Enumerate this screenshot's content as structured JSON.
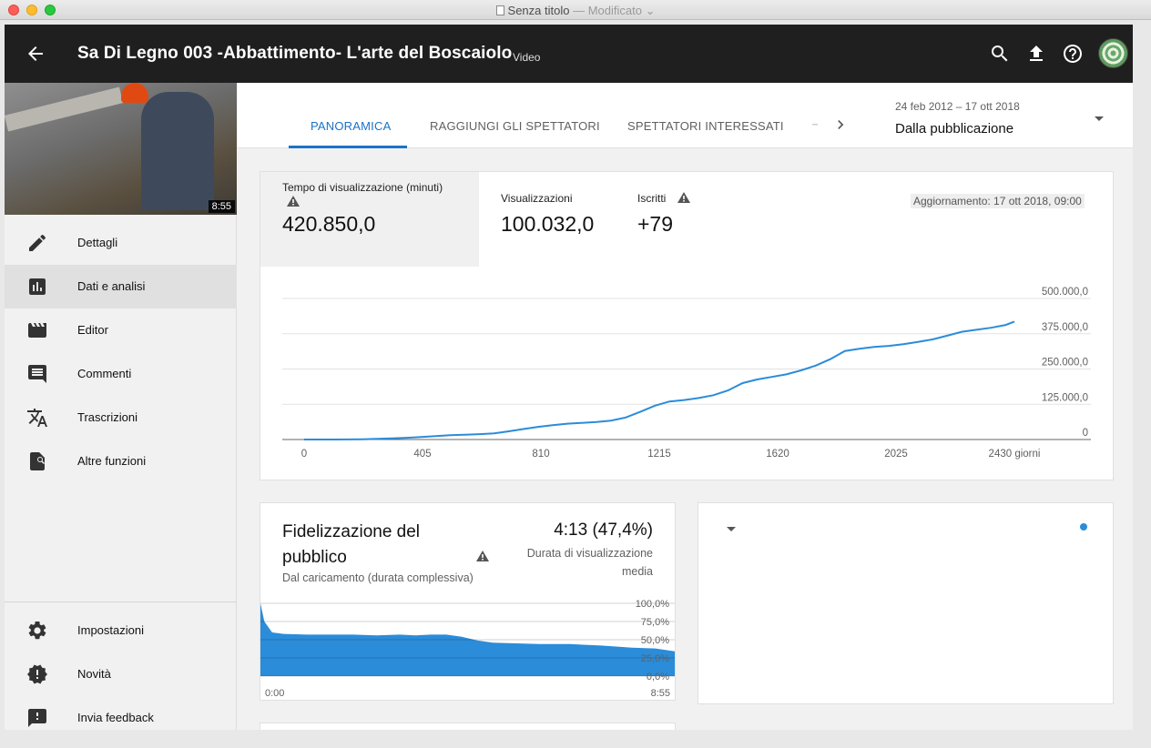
{
  "window": {
    "title": "Senza titolo",
    "status": "— Modificato ⌄"
  },
  "header": {
    "video_title": "Sa Di Legno 003 -Abbattimento- L'arte del Boscaiolo",
    "video_tag": "Video",
    "icons": [
      "arrow-back-icon",
      "search-icon",
      "upload-icon",
      "help-icon",
      "avatar"
    ]
  },
  "sidebar": {
    "thumbnail_duration": "8:55",
    "items": [
      {
        "label": "Dettagli",
        "icon": "pencil-icon"
      },
      {
        "label": "Dati e analisi",
        "icon": "analytics-icon"
      },
      {
        "label": "Editor",
        "icon": "clapperboard-icon"
      },
      {
        "label": "Commenti",
        "icon": "comment-icon"
      },
      {
        "label": "Trascrizioni",
        "icon": "translate-icon"
      },
      {
        "label": "Altre funzioni",
        "icon": "more-features-icon"
      }
    ],
    "bottom_items": [
      {
        "label": "Impostazioni",
        "icon": "gear-icon"
      },
      {
        "label": "Novità",
        "icon": "whats-new-icon"
      },
      {
        "label": "Invia feedback",
        "icon": "feedback-icon"
      }
    ]
  },
  "tabs": [
    {
      "label": "PANORAMICA",
      "active": true
    },
    {
      "label": "RAGGIUNGI GLI SPETTATORI",
      "active": false
    },
    {
      "label": "SPETTATORI INTERESSATI",
      "active": false
    }
  ],
  "date_filter": {
    "range": "24 feb 2012 – 17 ott 2018",
    "selected": "Dalla pubblicazione"
  },
  "overview": {
    "metrics": [
      {
        "label": "Tempo di visualizzazione (minuti)",
        "value": "420.850,0",
        "warning": true
      },
      {
        "label": "Visualizzazioni",
        "value": "100.032,0",
        "warning": false
      },
      {
        "label": "Iscritti",
        "value": "+79",
        "warning": true
      }
    ],
    "updated": "Aggiornamento: 17 ott 2018, 09:00"
  },
  "retention": {
    "title": "Fidelizzazione del pubblico",
    "subtitle": "Dal caricamento (durata complessiva)",
    "value": "4:13 (47,4%)",
    "caption": "Durata di visualizzazione media"
  },
  "accent_color": "#2b8cd9",
  "chart_data": [
    {
      "type": "line",
      "title": "",
      "xlabel": "",
      "ylabel": "",
      "x_ticks": [
        "0",
        "405",
        "810",
        "1215",
        "1620",
        "2025",
        "2430 giorni"
      ],
      "x_tick_values": [
        0,
        405,
        810,
        1215,
        1620,
        2025,
        2430
      ],
      "y_ticks": [
        "0",
        "125.000,0",
        "250.000,0",
        "375.000,0",
        "500.000,0"
      ],
      "y_tick_values": [
        0,
        125000,
        250000,
        375000,
        500000
      ],
      "xlim": [
        0,
        2430
      ],
      "ylim": [
        0,
        500000
      ],
      "grid": true,
      "series": [
        {
          "color": "#2b8cd9",
          "x": [
            0,
            100,
            200,
            250,
            300,
            350,
            400,
            450,
            500,
            550,
            600,
            650,
            700,
            750,
            800,
            850,
            900,
            950,
            1000,
            1050,
            1100,
            1150,
            1200,
            1250,
            1300,
            1350,
            1400,
            1450,
            1500,
            1550,
            1600,
            1650,
            1700,
            1750,
            1800,
            1850,
            1900,
            1950,
            2000,
            2050,
            2100,
            2150,
            2200,
            2250,
            2300,
            2350,
            2400,
            2430
          ],
          "y": [
            0,
            0,
            1000,
            2500,
            4000,
            6000,
            9000,
            12000,
            15000,
            17000,
            19000,
            22000,
            29000,
            37000,
            45000,
            51000,
            56000,
            59000,
            62000,
            67000,
            78000,
            98000,
            120000,
            135000,
            140000,
            147000,
            157000,
            174000,
            200000,
            213000,
            222000,
            231000,
            245000,
            262000,
            285000,
            314000,
            322000,
            328000,
            332000,
            338000,
            346000,
            355000,
            368000,
            382000,
            389000,
            396000,
            406000,
            418000
          ]
        }
      ]
    },
    {
      "type": "area",
      "title": "",
      "x_ticks": [
        "0:00",
        "8:55"
      ],
      "y_ticks": [
        "0,0%",
        "25,0%",
        "50,0%",
        "75,0%",
        "100,0%"
      ],
      "y_tick_values": [
        0,
        25,
        50,
        75,
        100
      ],
      "xlim": [
        0,
        535
      ],
      "ylim": [
        0,
        100
      ],
      "grid": true,
      "series": [
        {
          "color": "#2b8cd9",
          "x": [
            0,
            5,
            15,
            30,
            60,
            90,
            120,
            150,
            180,
            200,
            220,
            240,
            260,
            280,
            300,
            330,
            360,
            400,
            440,
            480,
            510,
            535
          ],
          "y": [
            100,
            75,
            60,
            58,
            57,
            57,
            57,
            56,
            57,
            56,
            57,
            57,
            54,
            49,
            46,
            45,
            44,
            44,
            42,
            39,
            38,
            34
          ]
        }
      ]
    }
  ]
}
